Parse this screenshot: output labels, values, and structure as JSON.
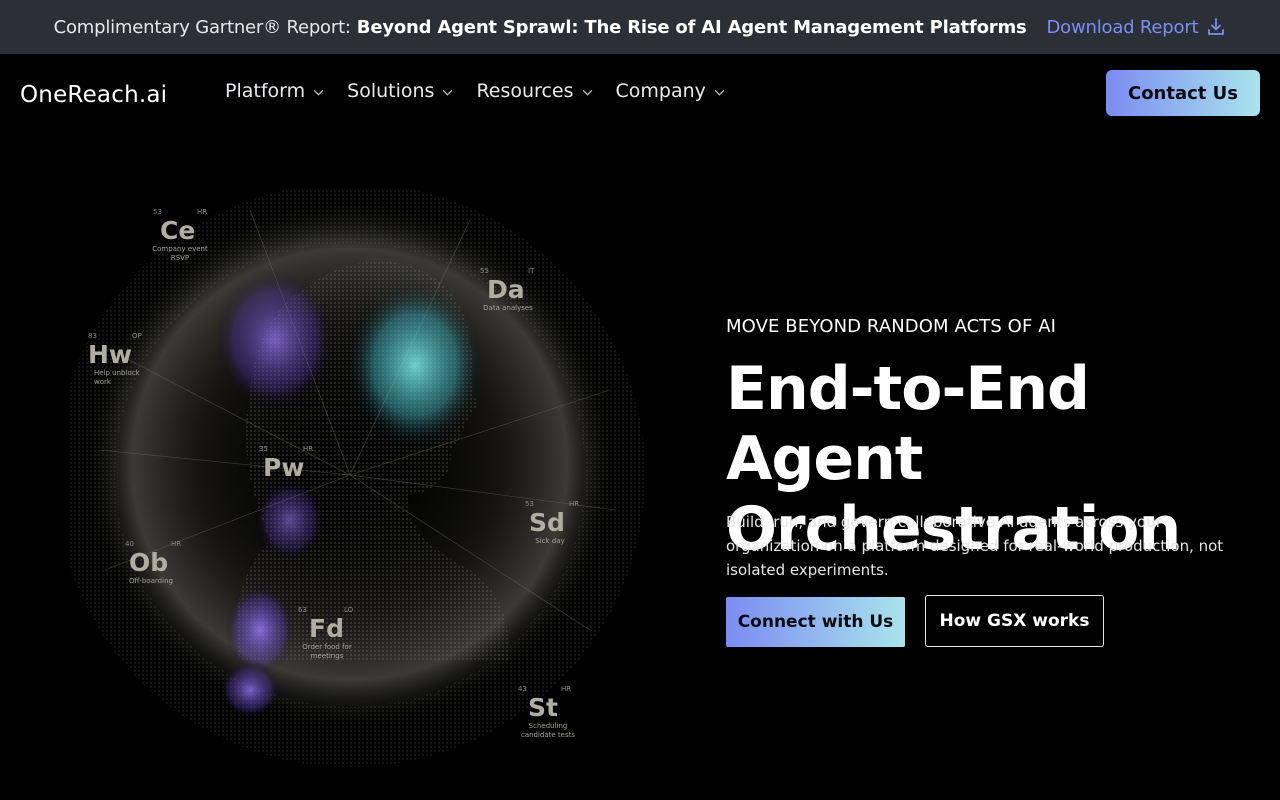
{
  "announcement": {
    "lead": "Complimentary Gartner® Report:",
    "title": "Beyond Agent Sprawl: The Rise of AI Agent Management Platforms",
    "link_label": "Download Report",
    "link_icon": "download-icon"
  },
  "header": {
    "logo_text": "OneReach.ai",
    "nav": [
      {
        "label": "Platform",
        "icon": "chevron-down-icon"
      },
      {
        "label": "Solutions",
        "icon": "chevron-down-icon"
      },
      {
        "label": "Resources",
        "icon": "chevron-down-icon"
      },
      {
        "label": "Company",
        "icon": "chevron-down-icon"
      }
    ],
    "cta_label": "Contact Us"
  },
  "hero": {
    "eyebrow": "MOVE BEYOND RANDOM ACTS OF AI",
    "headline_line1": "End-to-End Agent",
    "headline_line2": "Orchestration",
    "subtext": "Build, run, and govern collaborative AI agents across your organization on a platform designed for real-world production, not isolated experiments.",
    "primary_button": "Connect with Us",
    "secondary_button": "How GSX works"
  },
  "art_elements": [
    {
      "symbol": "Ce",
      "number": "53",
      "category": "HR",
      "desc": "Company event RSVP"
    },
    {
      "symbol": "Da",
      "number": "55",
      "category": "IT",
      "desc": "Data analyses"
    },
    {
      "symbol": "Hw",
      "number": "83",
      "category": "OP",
      "desc": "Help unblock work"
    },
    {
      "symbol": "Pw",
      "number": "35",
      "category": "HR",
      "desc": ""
    },
    {
      "symbol": "Sd",
      "number": "53",
      "category": "HR",
      "desc": "Sick day"
    },
    {
      "symbol": "Ob",
      "number": "40",
      "category": "HR",
      "desc": "Off-boarding"
    },
    {
      "symbol": "Fd",
      "number": "63",
      "category": "LO",
      "desc": "Order food for meetings"
    },
    {
      "symbol": "St",
      "number": "43",
      "category": "HR",
      "desc": "Scheduling candidate tests"
    }
  ],
  "colors": {
    "announcement_bg": "#2b2f36",
    "link": "#7a8ff5",
    "gradient_start": "#7b8cf2",
    "gradient_end": "#a9e4ec",
    "page_bg": "#000000",
    "art_purple": "#8a6cf0",
    "art_cyan": "#6fe3e3"
  }
}
